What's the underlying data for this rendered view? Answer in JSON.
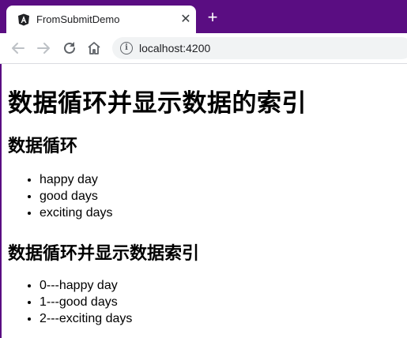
{
  "browser": {
    "tab_title": "FromSubmitDemo",
    "close_label": "✕",
    "new_tab_label": "+",
    "url": "localhost:4200"
  },
  "page": {
    "heading": "数据循环并显示数据的索引",
    "section1": {
      "title": "数据循环",
      "items": [
        "happy day",
        "good days",
        "exciting days"
      ]
    },
    "section2": {
      "title": "数据循环并显示数据索引",
      "items": [
        "0---happy day",
        "1---good days",
        "2---exciting days"
      ]
    }
  },
  "colors": {
    "tabbar": "#5a0d82",
    "omnibox": "#f1f3f4"
  }
}
